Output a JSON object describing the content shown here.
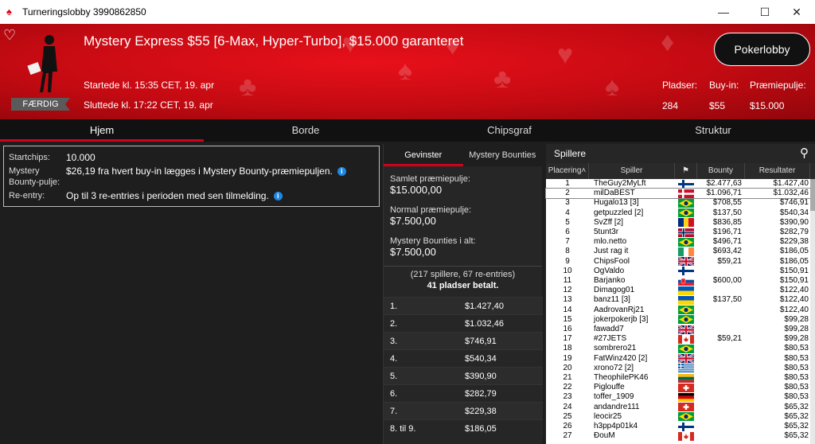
{
  "window": {
    "title": "Turneringslobby 3990862850"
  },
  "banner": {
    "tournament_name": "Mystery Express $55 [6-Max, Hyper-Turbo], $15.000 garanteret",
    "started": "Startede kl. 15:35 CET, 19. apr",
    "ended": "Sluttede kl. 17:22 CET, 19. apr",
    "status": "FÆRDIG",
    "lobby_button": "Pokerlobby",
    "seats_label": "Pladser:",
    "seats_value": "284",
    "buyin_label": "Buy-in:",
    "buyin_value": "$55",
    "prizepool_label": "Præmiepulje:",
    "prizepool_value": "$15.000"
  },
  "tabs": [
    "Hjem",
    "Borde",
    "Chipsgraf",
    "Struktur"
  ],
  "info": {
    "startchips_label": "Startchips:",
    "startchips_value": "10.000",
    "bounty_label_1": "Mystery",
    "bounty_label_2": "Bounty-pulje:",
    "bounty_value": "$26,19 fra hvert buy-in lægges i Mystery Bounty-præmiepuljen.",
    "reentry_label": "Re-entry:",
    "reentry_value": "Op til 3 re-entries i perioden med sen tilmelding."
  },
  "winnings": {
    "tab_winners": "Gevinster",
    "tab_bounties": "Mystery Bounties",
    "total_label": "Samlet præmiepulje:",
    "total_value": "$15.000,00",
    "normal_label": "Normal præmiepulje:",
    "normal_value": "$7.500,00",
    "bounties_label": "Mystery Bounties i alt:",
    "bounties_value": "$7.500,00",
    "players_summary": "(217 spillere, 67 re-entries)",
    "paid_summary": "41 pladser betalt.",
    "payouts": [
      {
        "pos": "1.",
        "amount": "$1.427,40"
      },
      {
        "pos": "2.",
        "amount": "$1.032,46"
      },
      {
        "pos": "3.",
        "amount": "$746,91"
      },
      {
        "pos": "4.",
        "amount": "$540,34"
      },
      {
        "pos": "5.",
        "amount": "$390,90"
      },
      {
        "pos": "6.",
        "amount": "$282,79"
      },
      {
        "pos": "7.",
        "amount": "$229,38"
      },
      {
        "pos": "8. til 9.",
        "amount": "$186,05"
      }
    ]
  },
  "players": {
    "title": "Spillere",
    "col_place": "Placering",
    "col_player": "Spiller",
    "col_bounty": "Bounty",
    "col_result": "Resultater",
    "rows": [
      {
        "place": "1",
        "name": "TheGuy2MyLft",
        "flag": "fi",
        "bounty": "$2.477,63",
        "result": "$1.427,40"
      },
      {
        "place": "2",
        "name": "milDaBEST",
        "flag": "dk",
        "bounty": "$1.096,71",
        "result": "$1.032,46"
      },
      {
        "place": "3",
        "name": "Hugalo13 [3]",
        "flag": "br",
        "bounty": "$708,55",
        "result": "$746,91"
      },
      {
        "place": "4",
        "name": "getpuzzled [2]",
        "flag": "br",
        "bounty": "$137,50",
        "result": "$540,34"
      },
      {
        "place": "5",
        "name": "SvZff [2]",
        "flag": "ro",
        "bounty": "$836,85",
        "result": "$390,90"
      },
      {
        "place": "6",
        "name": "5tunt3r",
        "flag": "no",
        "bounty": "$196,71",
        "result": "$282,79"
      },
      {
        "place": "7",
        "name": "mlo.netto",
        "flag": "br",
        "bounty": "$496,71",
        "result": "$229,38"
      },
      {
        "place": "8",
        "name": "Just rag it",
        "flag": "ie",
        "bounty": "$693,42",
        "result": "$186,05"
      },
      {
        "place": "9",
        "name": "ChipsFool",
        "flag": "gb",
        "bounty": "$59,21",
        "result": "$186,05"
      },
      {
        "place": "10",
        "name": "OgValdo",
        "flag": "fi",
        "bounty": "",
        "result": "$150,91"
      },
      {
        "place": "11",
        "name": "Barjanko",
        "flag": "sk",
        "bounty": "$600,00",
        "result": "$150,91"
      },
      {
        "place": "12",
        "name": "Dimagog01",
        "flag": "ua",
        "bounty": "",
        "result": "$122,40"
      },
      {
        "place": "13",
        "name": "banz11 [3]",
        "flag": "ua",
        "bounty": "$137,50",
        "result": "$122,40"
      },
      {
        "place": "14",
        "name": "AadrovanRj21",
        "flag": "br",
        "bounty": "",
        "result": "$122,40"
      },
      {
        "place": "15",
        "name": "jokerpokerjb [3]",
        "flag": "br",
        "bounty": "",
        "result": "$99,28"
      },
      {
        "place": "16",
        "name": "fawadd7",
        "flag": "gb",
        "bounty": "",
        "result": "$99,28"
      },
      {
        "place": "17",
        "name": "#27JETS",
        "flag": "ca",
        "bounty": "$59,21",
        "result": "$99,28"
      },
      {
        "place": "18",
        "name": "sombrero21",
        "flag": "br",
        "bounty": "",
        "result": "$80,53"
      },
      {
        "place": "19",
        "name": "FatWinz420 [2]",
        "flag": "gb",
        "bounty": "",
        "result": "$80,53"
      },
      {
        "place": "20",
        "name": "xrono72 [2]",
        "flag": "gr",
        "bounty": "",
        "result": "$80,53"
      },
      {
        "place": "21",
        "name": "TheophilePK46",
        "flag": "lt",
        "bounty": "",
        "result": "$80,53"
      },
      {
        "place": "22",
        "name": "Piglouffe",
        "flag": "ch",
        "bounty": "",
        "result": "$80,53"
      },
      {
        "place": "23",
        "name": "toffer_1909",
        "flag": "de",
        "bounty": "",
        "result": "$80,53"
      },
      {
        "place": "24",
        "name": "andandre111",
        "flag": "ch",
        "bounty": "",
        "result": "$65,32"
      },
      {
        "place": "25",
        "name": "leocir25",
        "flag": "br",
        "bounty": "",
        "result": "$65,32"
      },
      {
        "place": "26",
        "name": "h3pp4p01k4",
        "flag": "fi",
        "bounty": "",
        "result": "$65,32"
      },
      {
        "place": "27",
        "name": "ĐouM",
        "flag": "ca",
        "bounty": "",
        "result": "$65,32"
      }
    ]
  },
  "colors": {
    "accent_red": "#d0021b",
    "banner_red": "#e8101a",
    "info_blue": "#1e88e5",
    "highlight_row": "#ffffff"
  }
}
